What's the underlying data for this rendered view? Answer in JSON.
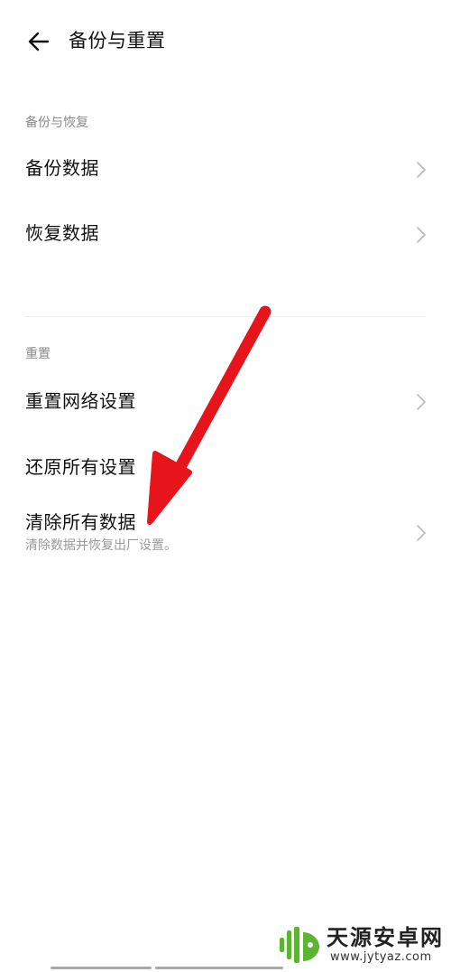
{
  "header": {
    "title": "备份与重置",
    "back_icon": "arrow-left-icon"
  },
  "sections": {
    "backup": {
      "label": "备份与恢复",
      "items": [
        {
          "title": "备份数据",
          "icon": "chevron-right-icon"
        },
        {
          "title": "恢复数据",
          "icon": "chevron-right-icon"
        }
      ]
    },
    "reset": {
      "label": "重置",
      "items": [
        {
          "title": "重置网络设置",
          "icon": "chevron-right-icon"
        },
        {
          "title": "还原所有设置"
        },
        {
          "title": "清除所有数据",
          "subtitle": "清除数据并恢复出厂设置。",
          "icon": "chevron-right-icon"
        }
      ]
    }
  },
  "annotation": {
    "arrow_color": "#e8141b",
    "icon": "red-arrow-icon"
  },
  "watermark": {
    "name": "天源安卓网",
    "url": "www.jytyaz.com",
    "logo_color": "#5cb531"
  },
  "colors": {
    "background": "#ffffff",
    "text_primary": "#111111",
    "text_secondary": "#8a8a8a",
    "chevron": "#bdbdbd"
  }
}
